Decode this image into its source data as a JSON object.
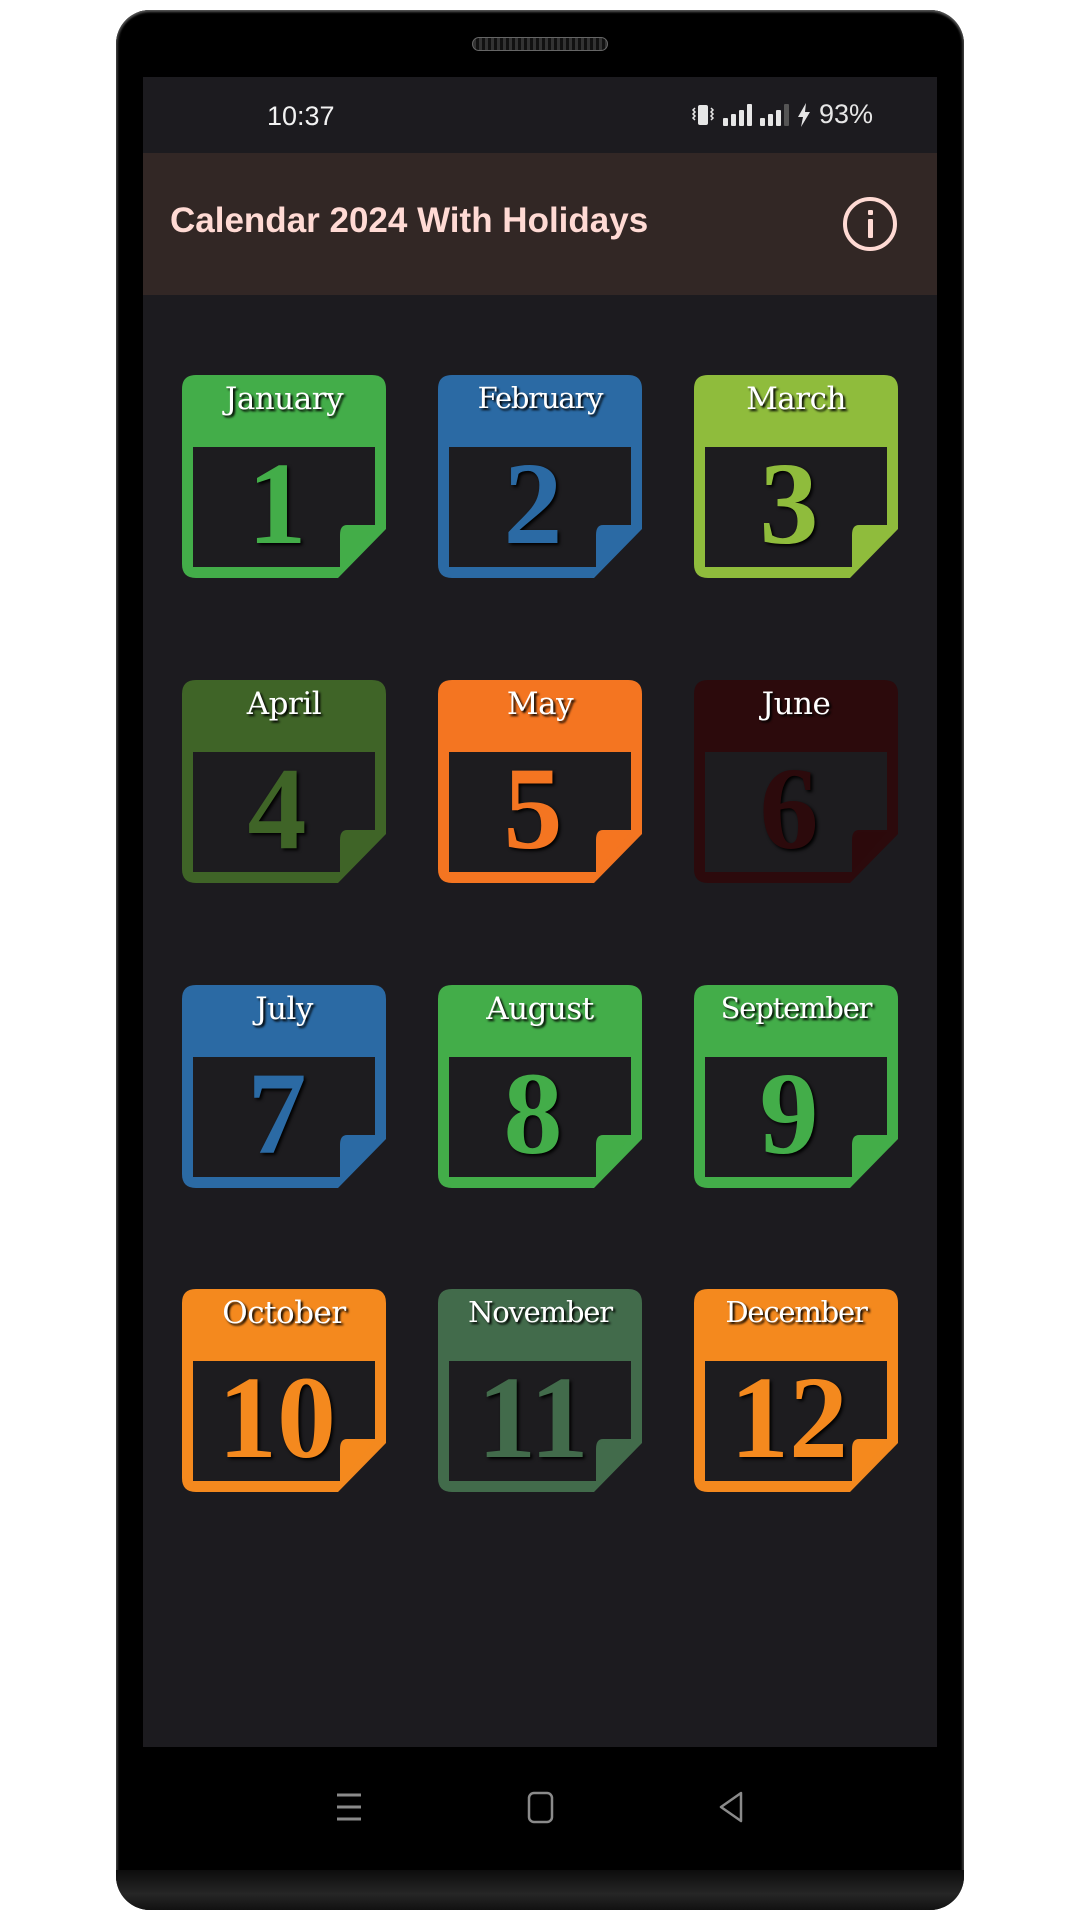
{
  "status_bar": {
    "time": "10:37",
    "battery": "93%",
    "icons": [
      "vibrate-icon",
      "signal-icon",
      "signal-icon",
      "charging-icon"
    ]
  },
  "header": {
    "title": "Calendar 2024 With Holidays",
    "info_icon": "info-icon"
  },
  "months": [
    {
      "name": "January",
      "number": "1",
      "color": "#43ad49"
    },
    {
      "name": "February",
      "number": "2",
      "color": "#2b6aa4"
    },
    {
      "name": "March",
      "number": "3",
      "color": "#8fbc3c"
    },
    {
      "name": "April",
      "number": "4",
      "color": "#3f6427"
    },
    {
      "name": "May",
      "number": "5",
      "color": "#f47521"
    },
    {
      "name": "June",
      "number": "6",
      "color": "#2c0a0c"
    },
    {
      "name": "July",
      "number": "7",
      "color": "#2b6aa4"
    },
    {
      "name": "August",
      "number": "8",
      "color": "#43ad49"
    },
    {
      "name": "September",
      "number": "9",
      "color": "#43ad49"
    },
    {
      "name": "October",
      "number": "10",
      "color": "#f4891e"
    },
    {
      "name": "November",
      "number": "11",
      "color": "#426b4b"
    },
    {
      "name": "December",
      "number": "12",
      "color": "#f4891e"
    }
  ],
  "nav": {
    "recents": "menu-icon",
    "home": "home-icon",
    "back": "back-icon"
  }
}
